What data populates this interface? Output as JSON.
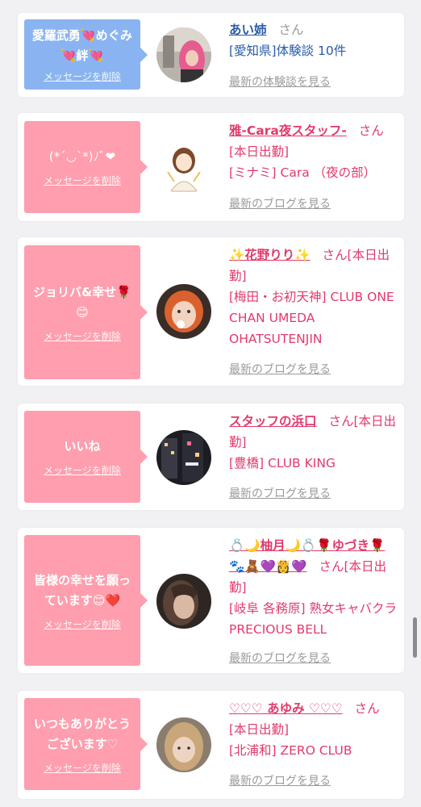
{
  "delete_label": "メッセージを削除",
  "cards": [
    {
      "message": "愛羅武勇💘めぐみ💘絆💘",
      "name": "あい姉",
      "san": "さん",
      "detail1": "[愛知県]体験談 10件",
      "detail2": "",
      "more": "最新の体験談を見る",
      "avatar_icon": "woman-photo-pink-hair"
    },
    {
      "message": "(*´◡`*)ﾉﾞ❤",
      "name": "雅-Cara夜スタッフ-",
      "san": "さん[本日出勤]",
      "detail1": "[ミナミ] Cara （夜の部）",
      "detail2": "",
      "more": "最新のブログを見る",
      "avatar_icon": "woman-illustration"
    },
    {
      "message": "ジョリバ&幸せ🌹😊",
      "name": "✨花野りり✨",
      "san": "さん[本日出勤]",
      "detail1": "[梅田・お初天神] CLUB ONE CHAN UMEDA OHATSUTENJIN",
      "detail2": "",
      "more": "最新のブログを見る",
      "avatar_icon": "woman-photo-orange-hair"
    },
    {
      "message": "いいね",
      "name": "スタッフの浜口",
      "san": "さん[本日出勤]",
      "detail1": "[豊橋] CLUB KING",
      "detail2": "",
      "more": "最新のブログを見る",
      "avatar_icon": "night-building-photo"
    },
    {
      "message": "皆様の幸せを願っています😊❤️",
      "name": "💍🌙柚月🌙💍🌹ゆづき🌹🐾🧸💜👸💜",
      "san": "さん[本日出勤]",
      "detail1": "[岐阜 各務原] 熟女キャバクラ PRECIOUS BELL",
      "detail2": "",
      "more": "最新のブログを見る",
      "avatar_icon": "woman-photo-dark"
    },
    {
      "message": "いつもありがとうございます♡",
      "name": "♡♡♡ あゆみ ♡♡♡",
      "san": "さん[本日出勤]",
      "detail1": "[北浦和] ZERO CLUB",
      "detail2": "",
      "more": "最新のブログを見る",
      "avatar_icon": "woman-photo-blonde"
    }
  ]
}
